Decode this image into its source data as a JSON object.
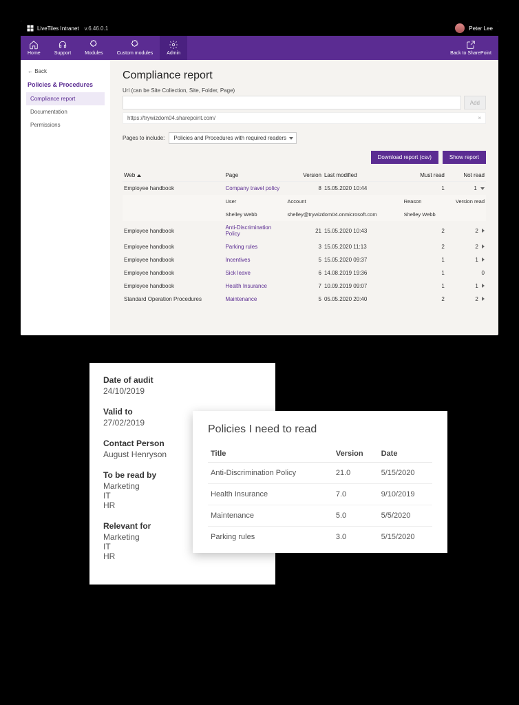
{
  "topbar": {
    "brand": "LiveTiles Intranet",
    "version": "v.6.46.0.1",
    "user": "Peter Lee"
  },
  "menu": {
    "items": [
      {
        "label": "Home"
      },
      {
        "label": "Support"
      },
      {
        "label": "Modules"
      },
      {
        "label": "Custom modules"
      },
      {
        "label": "Admin"
      }
    ],
    "back_to_sp": "Back to SharePoint"
  },
  "sidebar": {
    "back": "Back",
    "title": "Policies & Procedures",
    "items": [
      {
        "label": "Compliance report",
        "active": true
      },
      {
        "label": "Documentation"
      },
      {
        "label": "Permissions"
      }
    ]
  },
  "main": {
    "title": "Compliance report",
    "url_label": "Url (can be Site Collection, Site, Folder, Page)",
    "add_btn": "Add",
    "url_tag": "https://trywizdom04.sharepoint.com/",
    "url_tag_close": "×",
    "pages_label": "Pages to include:",
    "pages_dd": "Policies and Procedures with required readers",
    "download_btn": "Download report (csv)",
    "show_btn": "Show report"
  },
  "report": {
    "cols": {
      "web": "Web",
      "page": "Page",
      "version": "Version",
      "last": "Last modified",
      "must": "Must read",
      "not": "Not read"
    },
    "sub_cols": {
      "user": "User",
      "account": "Account",
      "reason": "Reason",
      "vread": "Version read"
    },
    "expanded": {
      "user": "Shelley Webb",
      "account": "shelley@trywizdom04.onmicrosoft.com",
      "reason": "Shelley Webb",
      "vread": ""
    },
    "rows": [
      {
        "web": "Employee handbook",
        "page": "Company travel policy",
        "version": "8",
        "last": "15.05.2020 10:44",
        "must": "1",
        "not": "1",
        "expanded": true
      },
      {
        "web": "Employee handbook",
        "page": "Anti-Discrimination Policy",
        "version": "21",
        "last": "15.05.2020 10:43",
        "must": "2",
        "not": "2"
      },
      {
        "web": "Employee handbook",
        "page": "Parking rules",
        "version": "3",
        "last": "15.05.2020 11:13",
        "must": "2",
        "not": "2"
      },
      {
        "web": "Employee handbook",
        "page": "Incentives",
        "version": "5",
        "last": "15.05.2020 09:37",
        "must": "1",
        "not": "1"
      },
      {
        "web": "Employee handbook",
        "page": "Sick leave",
        "version": "6",
        "last": "14.08.2019 19:36",
        "must": "1",
        "not": "0"
      },
      {
        "web": "Employee handbook",
        "page": "Health Insurance",
        "version": "7",
        "last": "10.09.2019 09:07",
        "must": "1",
        "not": "1"
      },
      {
        "web": "Standard Operation Procedures",
        "page": "Maintenance",
        "version": "5",
        "last": "05.05.2020 20:40",
        "must": "2",
        "not": "2"
      }
    ]
  },
  "meta_card": {
    "sections": [
      {
        "label": "Date of audit",
        "values": [
          "24/10/2019"
        ]
      },
      {
        "label": "Valid to",
        "values": [
          "27/02/2019"
        ]
      },
      {
        "label": "Contact Person",
        "values": [
          "August Henryson"
        ]
      },
      {
        "label": "To be read by",
        "values": [
          "Marketing",
          "IT",
          "HR"
        ]
      },
      {
        "label": "Relevant for",
        "values": [
          "Marketing",
          "IT",
          "HR"
        ]
      }
    ]
  },
  "pol_card": {
    "title": "Policies I need to read",
    "cols": {
      "title": "Title",
      "version": "Version",
      "date": "Date"
    },
    "rows": [
      {
        "title": "Anti-Discrimination Policy",
        "version": "21.0",
        "date": "5/15/2020"
      },
      {
        "title": "Health Insurance",
        "version": "7.0",
        "date": "9/10/2019"
      },
      {
        "title": "Maintenance",
        "version": "5.0",
        "date": "5/5/2020"
      },
      {
        "title": "Parking rules",
        "version": "3.0",
        "date": "5/15/2020"
      }
    ]
  }
}
